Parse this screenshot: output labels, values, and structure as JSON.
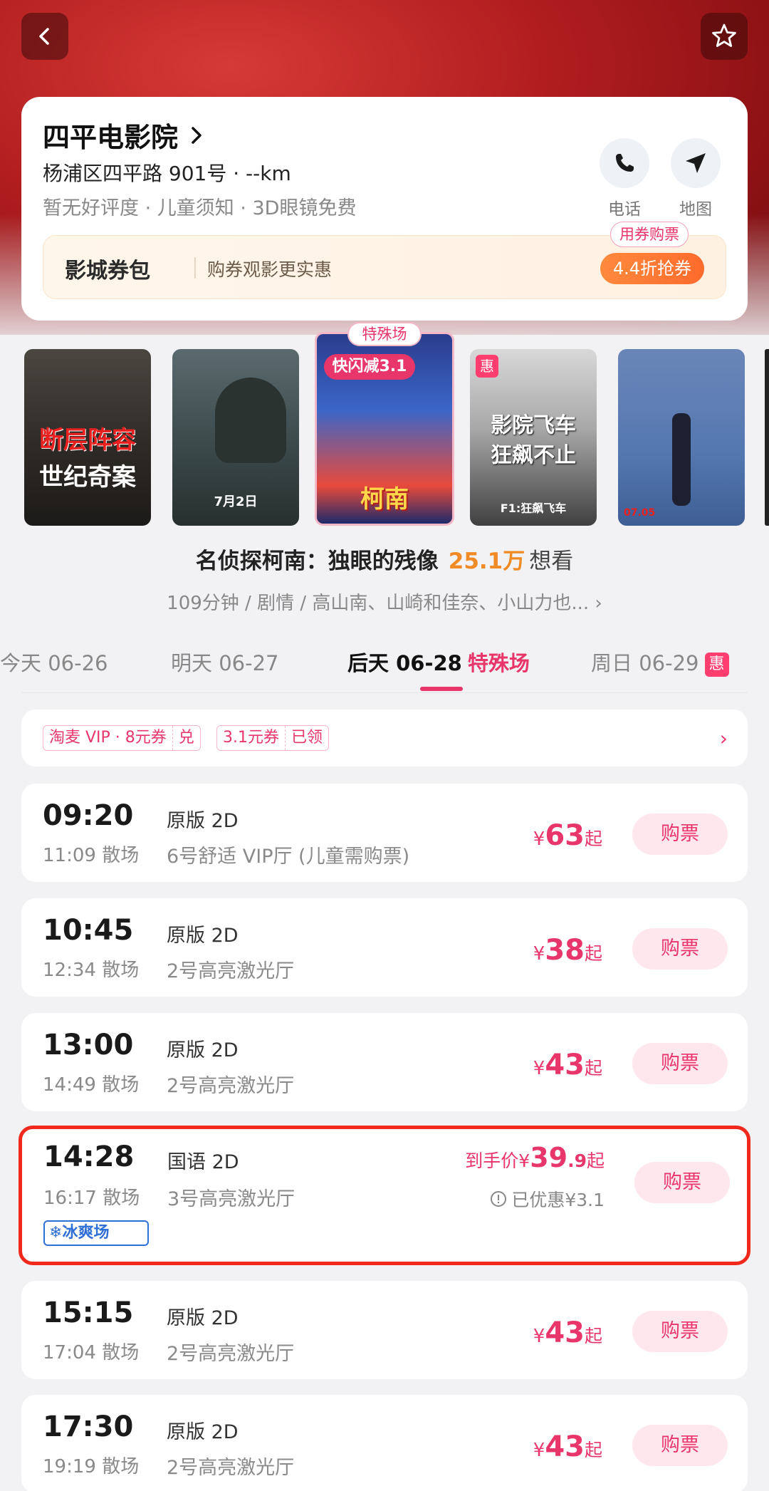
{
  "header": {
    "back_icon": "chevron-left-icon",
    "favorite_icon": "star-outline-icon"
  },
  "cinema": {
    "name": "四平电影院",
    "address": "杨浦区四平路 901号 · --km",
    "tags": "暂无好评度 · 儿童须知 · 3D眼镜免费",
    "phone_label": "电话",
    "map_label": "地图"
  },
  "coupon_pack": {
    "title": "影城券包",
    "subtitle": "购券观影更实惠",
    "button": "4.4折抢券",
    "tag": "用券购票"
  },
  "posters": {
    "special_tag": "特殊场",
    "flash_tag": "快闪减3.1",
    "hui_tag": "惠",
    "p1_line1": "断层阵容",
    "p1_line2": "世纪奇案",
    "p2_date": "7月2日",
    "p3_title": "柯南",
    "p4_line1": "影院飞车",
    "p4_line2": "狂飙不止",
    "p4_sub": "F1:狂飙飞车",
    "p5_date": "07.05"
  },
  "movie": {
    "title": "名侦探柯南：独眼的残像",
    "want_count": "25.1万",
    "want_label": "想看",
    "meta": "109分钟 / 剧情 / 高山南、山崎和佳奈、小山力也... ›"
  },
  "dates": [
    {
      "label": "今天  06-26"
    },
    {
      "label": "明天  06-27"
    },
    {
      "label": "后天  06-28",
      "special": "特殊场"
    },
    {
      "label": "周日  06-29",
      "badge": "惠"
    }
  ],
  "promo": {
    "chip1_a": "淘麦 VIP · 8元券",
    "chip1_b": "兑",
    "chip2_a": "3.1元券",
    "chip2_b": "已领"
  },
  "showtimes": [
    {
      "start": "09:20",
      "end": "11:09 散场",
      "lang": "原版 2D",
      "hall": "6号舒适 VIP厅 (儿童需购票)",
      "currency": "¥",
      "price": "63",
      "suffix": "起",
      "buy": "购票"
    },
    {
      "start": "10:45",
      "end": "12:34 散场",
      "lang": "原版 2D",
      "hall": "2号高亮激光厅",
      "currency": "¥",
      "price": "38",
      "suffix": "起",
      "buy": "购票"
    },
    {
      "start": "13:00",
      "end": "14:49 散场",
      "lang": "原版 2D",
      "hall": "2号高亮激光厅",
      "currency": "¥",
      "price": "43",
      "suffix": "起",
      "buy": "购票"
    },
    {
      "start": "14:28",
      "end": "16:17 散场",
      "lang": "国语 2D",
      "hall": "3号高亮激光厅",
      "price_prefix": "到手价¥",
      "price": "39",
      "price_dec": ".9",
      "suffix": "起",
      "saved": "已优惠¥3.1",
      "badge": "冰爽场",
      "buy": "购票"
    },
    {
      "start": "15:15",
      "end": "17:04 散场",
      "lang": "原版 2D",
      "hall": "2号高亮激光厅",
      "currency": "¥",
      "price": "43",
      "suffix": "起",
      "buy": "购票"
    },
    {
      "start": "17:30",
      "end": "19:19 散场",
      "lang": "原版 2D",
      "hall": "2号高亮激光厅",
      "currency": "¥",
      "price": "43",
      "suffix": "起",
      "buy": "购票"
    }
  ],
  "colors": {
    "accent": "#e8356a",
    "highlight_border": "#f0291c",
    "want_orange": "#f08a25"
  }
}
